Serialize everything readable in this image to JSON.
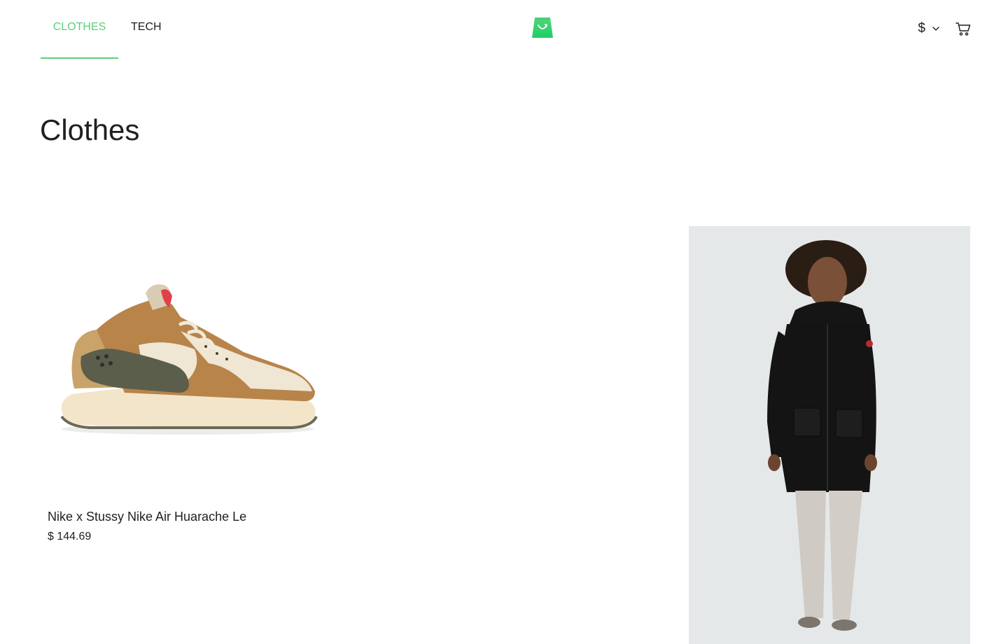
{
  "nav": {
    "tabs": [
      {
        "label": "CLOTHES",
        "active": true
      },
      {
        "label": "TECH",
        "active": false
      }
    ]
  },
  "brand": {
    "logo_icon": "shopping-bag-icon",
    "accent_color": "#5ece7b"
  },
  "header_actions": {
    "currency_symbol": "$",
    "currency_icon": "chevron-down-icon",
    "cart_icon": "cart-icon"
  },
  "page": {
    "title": "Clothes"
  },
  "products": [
    {
      "name": "Nike x Stussy Nike Air Huarache Le",
      "price_symbol": "$",
      "price_amount": "144.69",
      "image_icon": "sneaker-image"
    },
    {
      "name": "",
      "price_symbol": "",
      "price_amount": "",
      "image_icon": "jacket-model-image"
    }
  ]
}
